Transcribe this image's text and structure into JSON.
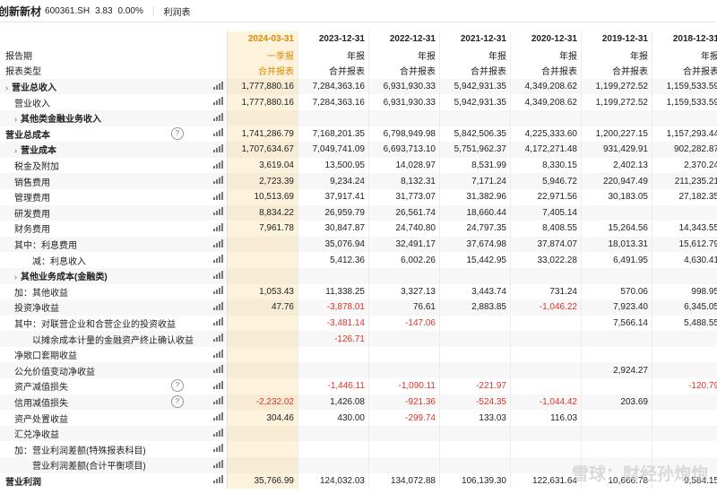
{
  "header": {
    "company": "创新新材",
    "code": "600361.SH",
    "price": "3.83",
    "change": "0.00%",
    "tab": "利润表"
  },
  "dates": [
    "2024-03-31",
    "2023-12-31",
    "2022-12-31",
    "2021-12-31",
    "2020-12-31",
    "2019-12-31",
    "2018-12-31"
  ],
  "header_rows": [
    {
      "label": "报告期",
      "values": [
        "一季报",
        "年报",
        "年报",
        "年报",
        "年报",
        "年报",
        "年报"
      ]
    },
    {
      "label": "报表类型",
      "values": [
        "合并报表",
        "合并报表",
        "合并报表",
        "合并报表",
        "合并报表",
        "合并报表",
        "合并报表"
      ]
    }
  ],
  "rows": [
    {
      "label": "营业总收入",
      "chevron": true,
      "bold": true,
      "values": [
        "1,777,880.16",
        "7,284,363.16",
        "6,931,930.33",
        "5,942,931.35",
        "4,349,208.62",
        "1,199,272.52",
        "1,159,533.59"
      ]
    },
    {
      "label": "营业收入",
      "indent": 1,
      "values": [
        "1,777,880.16",
        "7,284,363.16",
        "6,931,930.33",
        "5,942,931.35",
        "4,349,208.62",
        "1,199,272.52",
        "1,159,533.59"
      ]
    },
    {
      "label": "其他类金融业务收入",
      "chevron": true,
      "bold": true,
      "indent": 1,
      "values": [
        "",
        "",
        "",
        "",
        "",
        "",
        ""
      ]
    },
    {
      "label": "营业总成本",
      "bold": true,
      "info": true,
      "values": [
        "1,741,286.79",
        "7,168,201.35",
        "6,798,949.98",
        "5,842,506.35",
        "4,225,333.60",
        "1,200,227.15",
        "1,157,293.44"
      ]
    },
    {
      "label": "营业成本",
      "chevron": true,
      "bold": true,
      "indent": 1,
      "values": [
        "1,707,634.67",
        "7,049,741.09",
        "6,693,713.10",
        "5,751,962.37",
        "4,172,271.48",
        "931,429.91",
        "902,282.87"
      ]
    },
    {
      "label": "税金及附加",
      "indent": 1,
      "values": [
        "3,619.04",
        "13,500.95",
        "14,028.97",
        "8,531.99",
        "8,330.15",
        "2,402.13",
        "2,370.24"
      ]
    },
    {
      "label": "销售费用",
      "indent": 1,
      "values": [
        "2,723.39",
        "9,234.24",
        "8,132.31",
        "7,171.24",
        "5,946.72",
        "220,947.49",
        "211,235.21"
      ]
    },
    {
      "label": "管理费用",
      "indent": 1,
      "values": [
        "10,513.69",
        "37,917.41",
        "31,773.07",
        "31,382.96",
        "22,971.56",
        "30,183.05",
        "27,182.35"
      ]
    },
    {
      "label": "研发费用",
      "indent": 1,
      "values": [
        "8,834.22",
        "26,959.79",
        "26,561.74",
        "18,660.44",
        "7,405.14",
        "",
        ""
      ]
    },
    {
      "label": "财务费用",
      "indent": 1,
      "values": [
        "7,961.78",
        "30,847.87",
        "24,740.80",
        "24,797.35",
        "8,408.55",
        "15,264.56",
        "14,343.55"
      ]
    },
    {
      "label": "其中：利息费用",
      "indent": 1,
      "values": [
        "",
        "35,076.94",
        "32,491.17",
        "37,674.98",
        "37,874.07",
        "18,013.31",
        "15,612.79"
      ]
    },
    {
      "label": "减：利息收入",
      "indent": 3,
      "values": [
        "",
        "5,412.36",
        "6,002.26",
        "15,442.95",
        "33,022.28",
        "6,491.95",
        "4,630.41"
      ]
    },
    {
      "label": "其他业务成本(金融类)",
      "chevron": true,
      "bold": true,
      "indent": 1,
      "values": [
        "",
        "",
        "",
        "",
        "",
        "",
        ""
      ]
    },
    {
      "label": "加：其他收益",
      "indent": 1,
      "values": [
        "1,053.43",
        "11,338.25",
        "3,327.13",
        "3,443.74",
        "731.24",
        "570.06",
        "998.95"
      ]
    },
    {
      "label": "投资净收益",
      "indent": 1,
      "values": [
        "47.76",
        "-3,878.01",
        "76.61",
        "2,883.85",
        "-1,046.22",
        "7,923.40",
        "6,345.05"
      ]
    },
    {
      "label": "其中：对联营企业和合营企业的投资收益",
      "indent": 1,
      "values": [
        "",
        "-3,481.14",
        "-147.06",
        "",
        "",
        "7,566.14",
        "5,488.55"
      ]
    },
    {
      "label": "以摊余成本计量的金融资产终止确认收益",
      "indent": 3,
      "values": [
        "",
        "-126.71",
        "",
        "",
        "",
        "",
        ""
      ]
    },
    {
      "label": "净敞口套期收益",
      "indent": 1,
      "values": [
        "",
        "",
        "",
        "",
        "",
        "",
        ""
      ]
    },
    {
      "label": "公允价值变动净收益",
      "indent": 1,
      "values": [
        "",
        "",
        "",
        "",
        "",
        "2,924.27",
        ""
      ]
    },
    {
      "label": "资产减值损失",
      "indent": 1,
      "info": true,
      "values": [
        "",
        "-1,446.11",
        "-1,090.11",
        "-221.97",
        "",
        "",
        "-120.79"
      ]
    },
    {
      "label": "信用减值损失",
      "indent": 1,
      "info": true,
      "values": [
        "-2,232.02",
        "1,426.08",
        "-921.36",
        "-524.35",
        "-1,044.42",
        "203.69",
        ""
      ]
    },
    {
      "label": "资产处置收益",
      "indent": 1,
      "values": [
        "304.46",
        "430.00",
        "-299.74",
        "133.03",
        "116.03",
        "",
        ""
      ]
    },
    {
      "label": "汇兑净收益",
      "indent": 1,
      "values": [
        "",
        "",
        "",
        "",
        "",
        "",
        ""
      ]
    },
    {
      "label": "加：营业利润差额(特殊报表科目)",
      "indent": 1,
      "values": [
        "",
        "",
        "",
        "",
        "",
        "",
        ""
      ]
    },
    {
      "label": "营业利润差额(合计平衡项目)",
      "indent": 3,
      "values": [
        "",
        "",
        "",
        "",
        "",
        "",
        ""
      ]
    },
    {
      "label": "营业利润",
      "bold": true,
      "values": [
        "35,766.99",
        "124,032.03",
        "134,072.88",
        "106,139.30",
        "122,631.64",
        "10,666.78",
        "9,584.15"
      ]
    }
  ],
  "watermark": "雪球：财经孙炮炮"
}
